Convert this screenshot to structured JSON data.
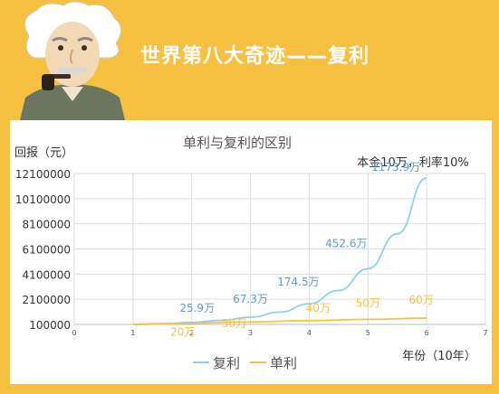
{
  "header": {
    "title": "世界第八大奇迹——复利"
  },
  "colors": {
    "background": "#f6c140",
    "compound": "#8fd0ea",
    "simple": "#f6c244",
    "compound_label": "#5b9bd5",
    "simple_label": "#f6c244"
  },
  "chart_data": {
    "type": "line",
    "title": "单利与复利的区别",
    "subtitle": "本金10万，利率10%",
    "ylabel": "回报（元）",
    "xlabel": "年份（10年）",
    "xlim": [
      0,
      7
    ],
    "ylim": [
      100000,
      12100000
    ],
    "x_ticks": [
      "0",
      "1",
      "2",
      "3",
      "4",
      "5",
      "6",
      "7"
    ],
    "y_ticks": [
      "100000",
      "2100000",
      "4100000",
      "6100000",
      "8100000",
      "10100000",
      "12100000"
    ],
    "legend_position": "bottom",
    "grid": true,
    "series": [
      {
        "name": "复利",
        "color": "#8fd0ea",
        "x": [
          1,
          1.5,
          2,
          2.5,
          3,
          3.5,
          4,
          4.5,
          5,
          5.5,
          6
        ],
        "values": [
          100000,
          160000,
          259000,
          420000,
          673000,
          1080000,
          1745000,
          2800000,
          4526000,
          7300000,
          11739000
        ],
        "labels": [
          {
            "x": 2,
            "text": "25.9万"
          },
          {
            "x": 3,
            "text": "67.3万"
          },
          {
            "x": 4,
            "text": "174.5万"
          },
          {
            "x": 5,
            "text": "452.6万"
          },
          {
            "x": 6,
            "text": "1173.9万"
          }
        ]
      },
      {
        "name": "单利",
        "color": "#f6c244",
        "x": [
          1,
          2,
          3,
          4,
          5,
          6
        ],
        "values": [
          100000,
          200000,
          300000,
          400000,
          500000,
          600000
        ],
        "labels": [
          {
            "x": 2,
            "text": "20万"
          },
          {
            "x": 3,
            "text": "30万"
          },
          {
            "x": 4,
            "text": "40万"
          },
          {
            "x": 5,
            "text": "50万"
          },
          {
            "x": 6,
            "text": "60万"
          }
        ]
      }
    ]
  }
}
